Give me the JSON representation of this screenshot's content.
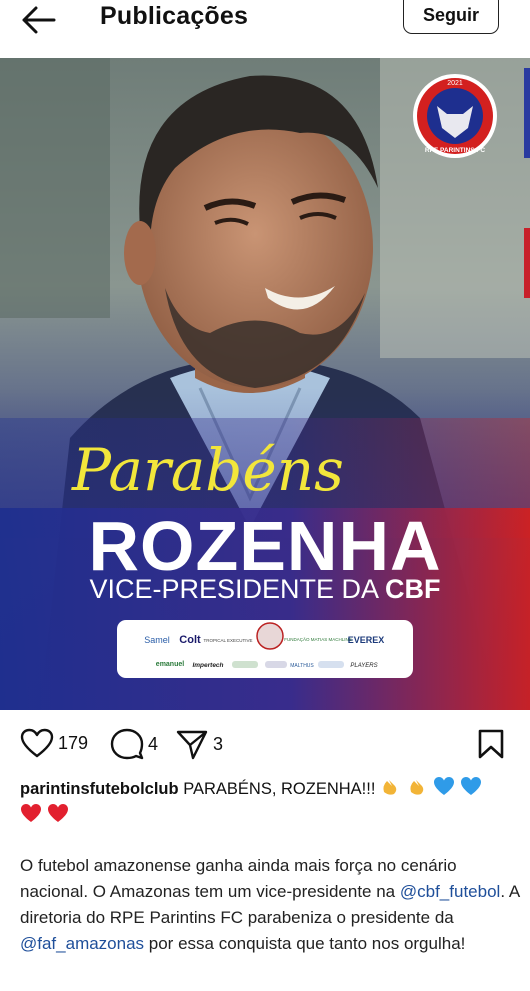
{
  "header": {
    "title": "Publicações",
    "follow_label": "Seguir"
  },
  "post": {
    "banner": {
      "script_line": "Parabéns",
      "name": "ROZENHA",
      "role": "VICE-PRESIDENTE DA ",
      "role_bold": "CBF",
      "badge_year": "2021",
      "badge_name": "RPE PARINTINS FC",
      "sponsors_row1": [
        "Samel",
        "Colt",
        "TROPICAL EXECUTIVE",
        "",
        "FUNDAÇÃO MATIAS MACHLINE",
        "EVEREX"
      ],
      "sponsors_row2": [
        "emanuel",
        "Impertech",
        "",
        "",
        "MALTHUS",
        "",
        "PLAYERS"
      ]
    },
    "likes": "179",
    "comments": "4",
    "shares": "3",
    "username": "parintinsfutebolclub",
    "caption_head": "PARABÉNS, ROZENHA!!!",
    "body_1": "O futebol amazonense ganha ainda mais força no cenário nacional. O Amazonas tem um vice-presidente na ",
    "mention_1": "@cbf_futebol",
    "body_2": ". A diretoria do RPE Parintins FC parabeniza o presidente da ",
    "mention_2": "@faf_amazonas",
    "body_3": " por essa conquista que tanto nos orgulha!"
  },
  "icons": {
    "back": "arrow-left-icon",
    "like": "heart-outline-icon",
    "comment": "comment-bubble-icon",
    "share": "paper-plane-icon",
    "save": "bookmark-icon",
    "clap": "clapping-hands-emoji",
    "blue_heart": "blue-heart-emoji",
    "red_heart": "red-heart-emoji"
  },
  "colors": {
    "banner_blue": "#1e2f8f",
    "banner_red": "#d3201f",
    "script_yellow": "#f2e63b",
    "mention_blue": "#1f4f9a"
  }
}
